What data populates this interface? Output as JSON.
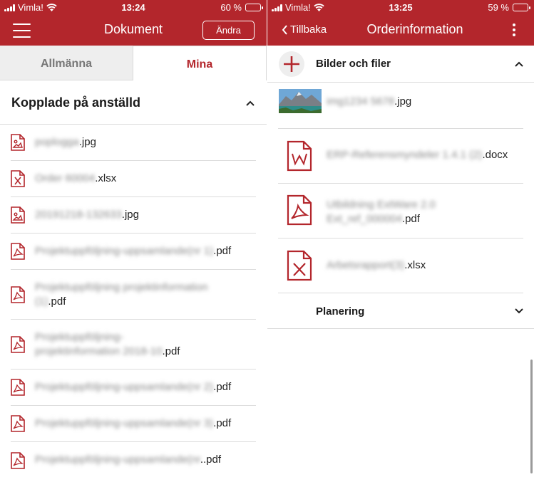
{
  "left": {
    "status": {
      "carrier": "Vimla!",
      "time": "13:24",
      "battery": "60 %",
      "battery_level": 0.6
    },
    "nav": {
      "title": "Dokument",
      "edit_label": "Ändra"
    },
    "tabs": [
      {
        "label": "Allmänna",
        "active": false
      },
      {
        "label": "Mina",
        "active": true
      }
    ],
    "section": {
      "title": "Kopplade på anställd"
    },
    "files": [
      {
        "icon": "image-file-icon",
        "blurred": "poplogga",
        "name": ".jpg"
      },
      {
        "icon": "excel-file-icon",
        "blurred": "Order 60004",
        "name": ".xlsx"
      },
      {
        "icon": "image-file-icon",
        "blurred": "20191218-132633",
        "name": ".jpg"
      },
      {
        "icon": "pdf-file-icon",
        "blurred": "Projektuppföljning-uppsamlande(nr 1)",
        "name": ".pdf"
      },
      {
        "icon": "pdf-file-icon",
        "blurred": "Projektuppföljning projektinformation",
        "blurred2": "(1)",
        "name": ".pdf"
      },
      {
        "icon": "pdf-file-icon",
        "blurred": "Projektuppföljning-",
        "blurred2": "projektinformation 2018-10",
        "name": ".pdf"
      },
      {
        "icon": "pdf-file-icon",
        "blurred": "Projektuppföljning-uppsamlande(nr 2)",
        "name": ".pdf"
      },
      {
        "icon": "pdf-file-icon",
        "blurred": "Projektuppföljning-uppsamlande(nr 3)",
        "name": ".pdf"
      },
      {
        "icon": "pdf-file-icon",
        "blurred": "Projektuppföljning-uppsamlande(nr",
        "name": "..pdf"
      }
    ]
  },
  "right": {
    "status": {
      "carrier": "Vimla!",
      "time": "13:25",
      "battery": "59 %",
      "battery_level": 0.59
    },
    "nav": {
      "back_label": "Tillbaka",
      "title": "Orderinformation"
    },
    "sections": [
      {
        "title": "Bilder och filer",
        "expanded": true
      },
      {
        "title": "Planering",
        "expanded": false
      }
    ],
    "files": [
      {
        "icon": "image-thumbnail",
        "blurred": "img1234 5678",
        "name": ".jpg"
      },
      {
        "icon": "word-file-icon",
        "blurred": "ERP-Referensmyndeler 1.4.1 (2)",
        "name": ".docx"
      },
      {
        "icon": "pdf-file-icon",
        "blurred": "Utbildning ExtWare 2.0",
        "blurred2": "Ext_ref_000004",
        "name": ".pdf"
      },
      {
        "icon": "excel-file-icon",
        "blurred": "Arbetsrapport(3)",
        "name": ".xlsx"
      }
    ]
  },
  "colors": {
    "brand": "#b3262c",
    "tab_bg": "#eeeeee",
    "divider": "#dcdcdc"
  }
}
